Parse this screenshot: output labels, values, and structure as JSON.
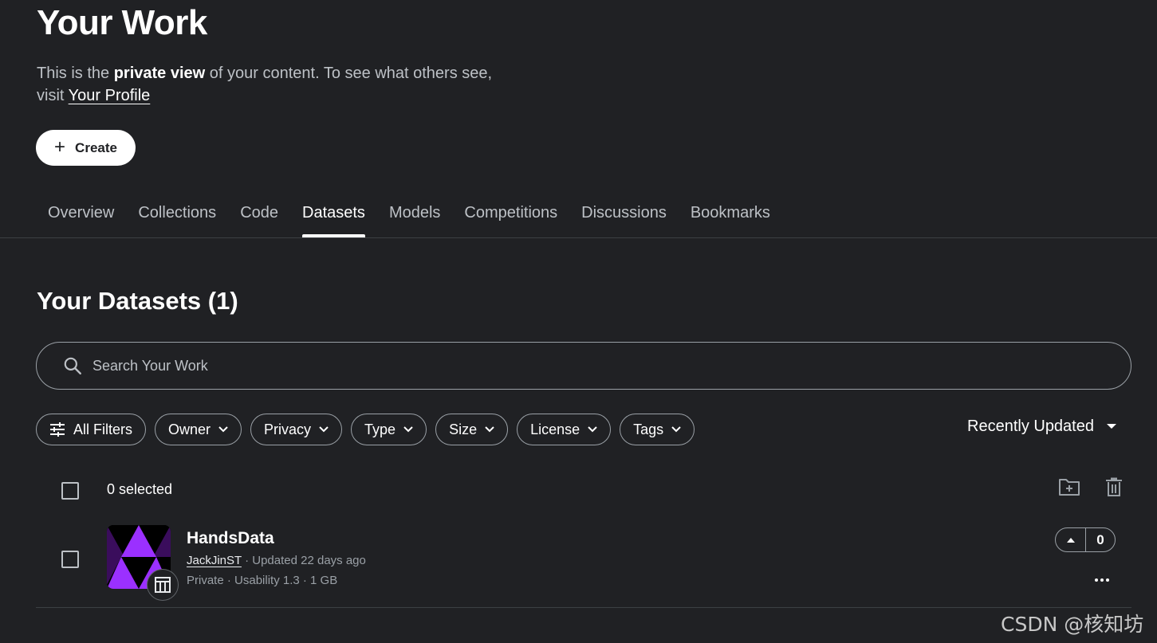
{
  "header": {
    "title": "Your Work",
    "subtitle_prefix": "This is the ",
    "subtitle_strong": "private view",
    "subtitle_middle": " of your content. To see what others see, visit ",
    "profile_link": "Your Profile",
    "create_label": "Create"
  },
  "tabs": [
    {
      "label": "Overview",
      "active": false
    },
    {
      "label": "Collections",
      "active": false
    },
    {
      "label": "Code",
      "active": false
    },
    {
      "label": "Datasets",
      "active": true
    },
    {
      "label": "Models",
      "active": false
    },
    {
      "label": "Competitions",
      "active": false
    },
    {
      "label": "Discussions",
      "active": false
    },
    {
      "label": "Bookmarks",
      "active": false
    }
  ],
  "section": {
    "title": "Your Datasets (1)"
  },
  "search": {
    "placeholder": "Search Your Work",
    "value": ""
  },
  "filters": {
    "all_filters": "All Filters",
    "owner": "Owner",
    "privacy": "Privacy",
    "type": "Type",
    "size": "Size",
    "license": "License",
    "tags": "Tags"
  },
  "sort": {
    "label": "Recently Updated"
  },
  "selection": {
    "label": "0 selected"
  },
  "dataset": {
    "title": "HandsData",
    "owner": "JackJinST",
    "updated": " · Updated 22 days ago",
    "meta": "Private · Usability 1.3 · 1 GB",
    "votes": "0"
  },
  "watermark": "CSDN @核知坊",
  "colors": {
    "background": "#202124",
    "accent": "#ffffff",
    "thumb_purple": "#9b30ff",
    "thumb_dark": "#3a0d5c"
  }
}
